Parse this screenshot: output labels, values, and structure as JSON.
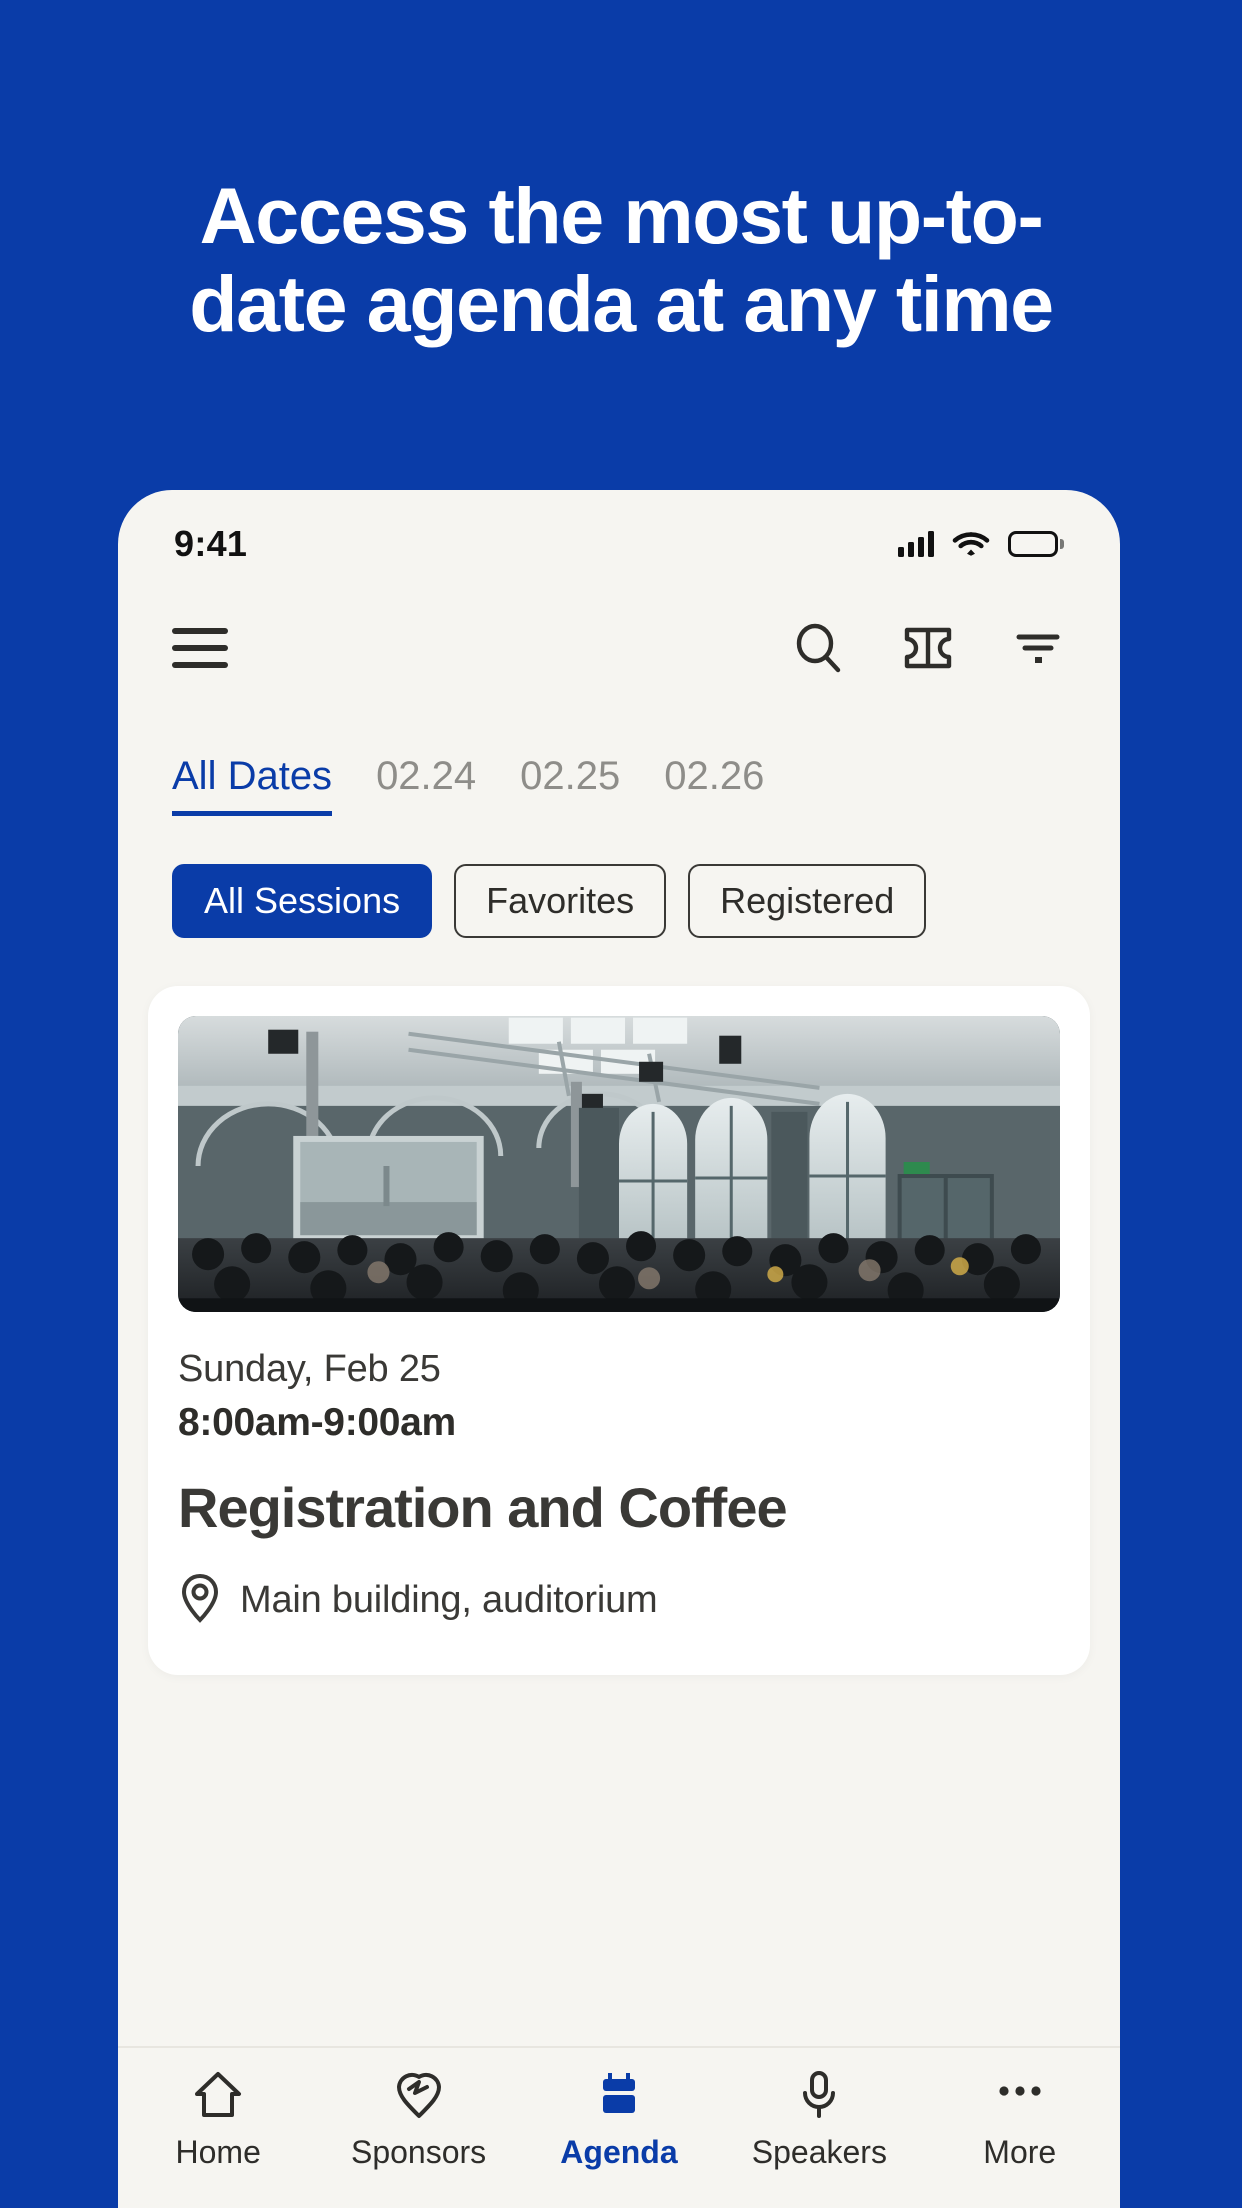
{
  "promo": {
    "headline_line1": "Access the most up-to-",
    "headline_line2": "date agenda at any time",
    "background_color": "#0A3CA8",
    "text_color": "#FFFFFF"
  },
  "phone": {
    "status_bar": {
      "time": "9:41",
      "icons": [
        "cellular-signal-icon",
        "wifi-icon",
        "battery-icon"
      ]
    },
    "toolbar": {
      "menu_icon": "hamburger-menu-icon",
      "search_icon": "search-icon",
      "ticket_icon": "ticket-icon",
      "filter_icon": "filter-icon"
    },
    "date_tabs": [
      {
        "label": "All Dates",
        "active": true
      },
      {
        "label": "02.24",
        "active": false
      },
      {
        "label": "02.25",
        "active": false
      },
      {
        "label": "02.26",
        "active": false
      }
    ],
    "filter_chips": [
      {
        "label": "All Sessions",
        "active": true
      },
      {
        "label": "Favorites",
        "active": false
      },
      {
        "label": "Registered",
        "active": false
      }
    ],
    "sessions": [
      {
        "image_alt": "conference-hall-crowd-photo",
        "date": "Sunday, Feb 25",
        "time": "8:00am-9:00am",
        "title": "Registration and Coffee",
        "location_icon": "location-pin-icon",
        "location": "Main building, auditorium"
      }
    ],
    "bottom_nav": [
      {
        "label": "Home",
        "icon": "home-icon",
        "active": false
      },
      {
        "label": "Sponsors",
        "icon": "heart-pin-icon",
        "active": false
      },
      {
        "label": "Agenda",
        "icon": "calendar-icon",
        "active": true
      },
      {
        "label": "Speakers",
        "icon": "microphone-icon",
        "active": false
      },
      {
        "label": "More",
        "icon": "ellipsis-icon",
        "active": false
      }
    ],
    "accent_color": "#0A3CA8",
    "surface_color": "#F6F5F1",
    "card_color": "#FFFFFF"
  }
}
